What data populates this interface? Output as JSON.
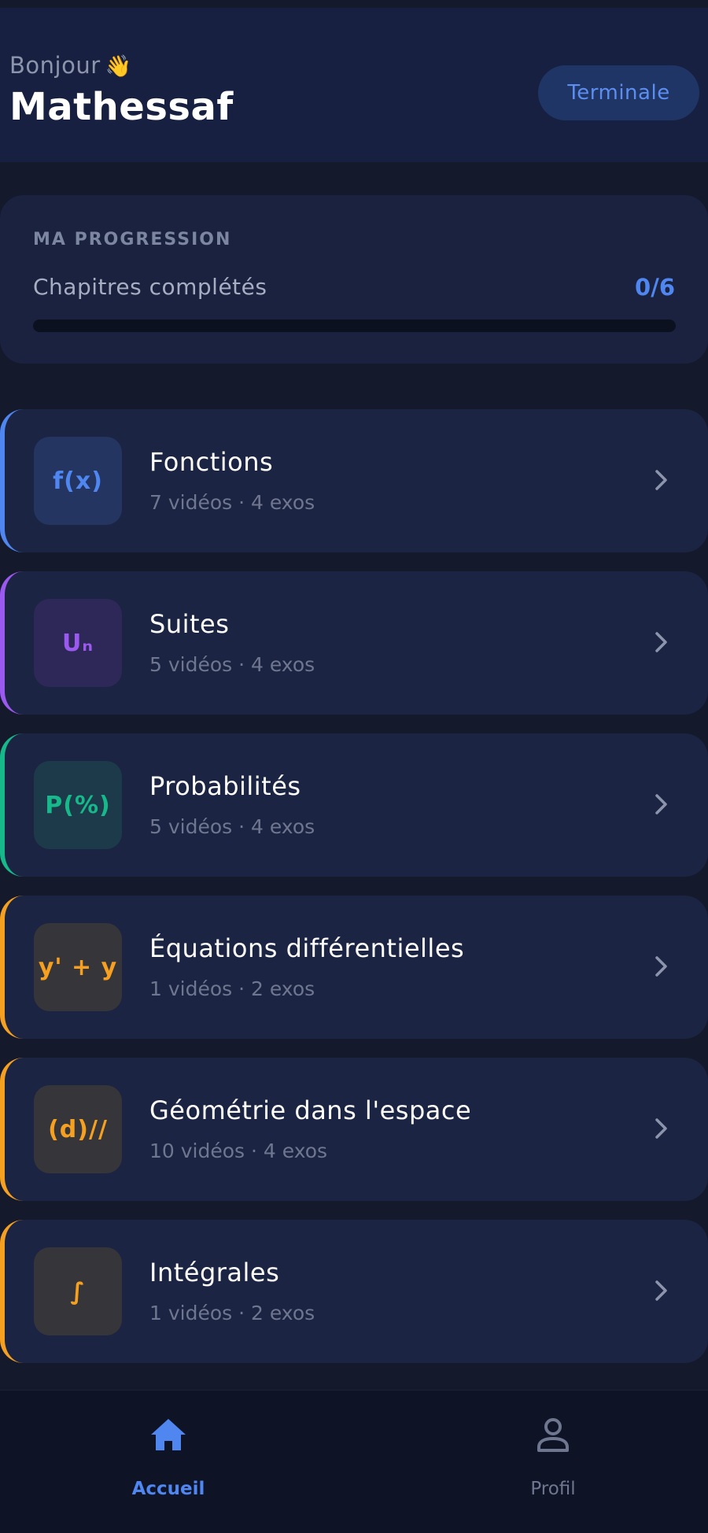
{
  "header": {
    "greeting": "Bonjour",
    "greeting_emoji": "👋",
    "username": "Mathessaf",
    "level": "Terminale"
  },
  "progress": {
    "title": "MA PROGRESSION",
    "label": "Chapitres complétés",
    "count": "0/6",
    "completed": 0,
    "total": 6
  },
  "chapters": [
    {
      "title": "Fonctions",
      "meta": "7 vidéos · 4 exos",
      "icon_text": "f(x)",
      "accent": "#4f86f0",
      "icon_bg": "#233560",
      "icon_color": "#4f86f0"
    },
    {
      "title": "Suites",
      "meta": "5 vidéos · 4 exos",
      "icon_text": "Uₙ",
      "accent": "#9b59f0",
      "icon_bg": "#2e2858",
      "icon_color": "#9b59f0"
    },
    {
      "title": "Probabilités",
      "meta": "5 vidéos · 4 exos",
      "icon_text": "P(%)",
      "accent": "#17b88a",
      "icon_bg": "#1c3a4a",
      "icon_color": "#17b88a"
    },
    {
      "title": "Équations différentielles",
      "meta": "1 vidéos · 2 exos",
      "icon_text": "y' + y",
      "accent": "#f5a020",
      "icon_bg": "#363539",
      "icon_color": "#f5a020"
    },
    {
      "title": "Géométrie dans l'espace",
      "meta": "10 vidéos · 4 exos",
      "icon_text": "(d)//",
      "accent": "#f5a020",
      "icon_bg": "#363539",
      "icon_color": "#f5a020"
    },
    {
      "title": "Intégrales",
      "meta": "1 vidéos · 2 exos",
      "icon_text": "∫",
      "accent": "#f5a020",
      "icon_bg": "#363539",
      "icon_color": "#f5a020"
    }
  ],
  "nav": {
    "home": {
      "label": "Accueil",
      "icon": "home-icon",
      "active": true,
      "color": "#4f86f0"
    },
    "profile": {
      "label": "Profil",
      "icon": "user-icon",
      "active": false,
      "color": "#6f7790"
    }
  }
}
